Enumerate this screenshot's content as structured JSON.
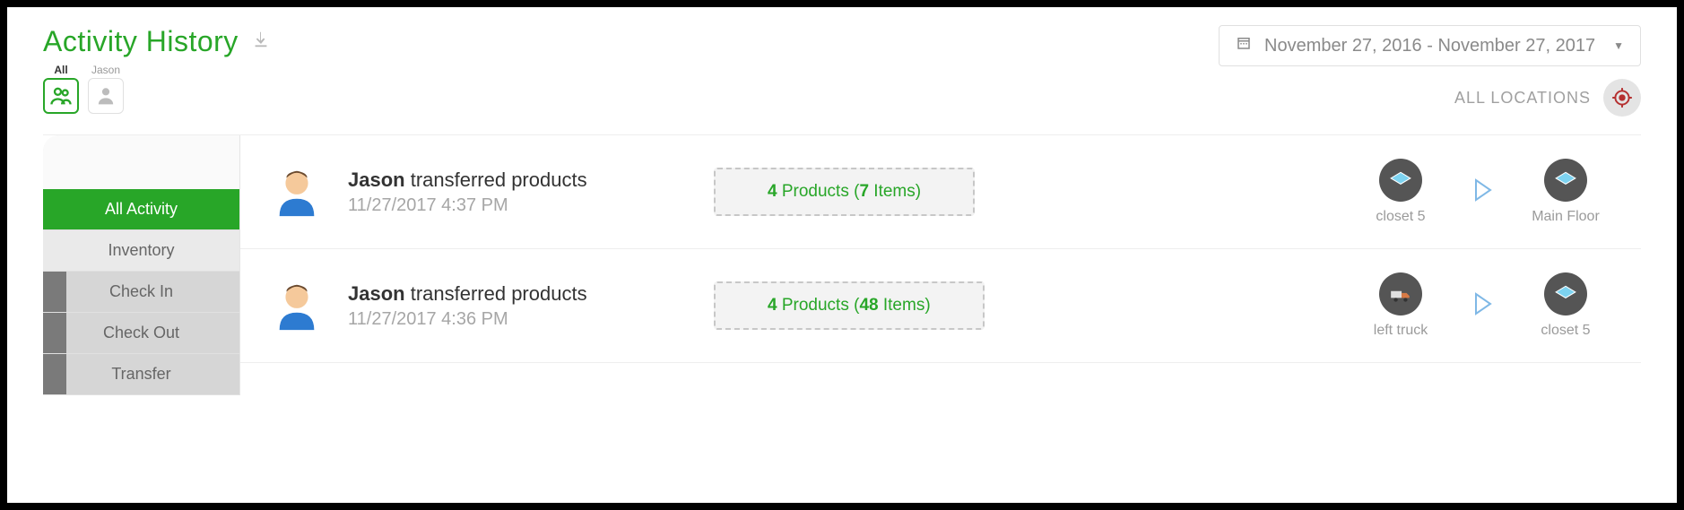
{
  "page": {
    "title": "Activity History",
    "locations_label": "ALL LOCATIONS"
  },
  "dateRange": {
    "text": "November 27, 2016 - November 27, 2017"
  },
  "userFilters": {
    "all": {
      "label": "All"
    },
    "jason": {
      "label": "Jason"
    }
  },
  "sidebar": {
    "items": [
      {
        "label": "All Activity"
      },
      {
        "label": "Inventory"
      },
      {
        "label": "Check In"
      },
      {
        "label": "Check Out"
      },
      {
        "label": "Transfer"
      }
    ]
  },
  "activities": [
    {
      "who": "Jason",
      "verb": " transferred products",
      "time": "11/27/2017 4:37 PM",
      "products_count": "4",
      "products_word": " Products (",
      "items_count": "7",
      "items_word": " Items)",
      "from": "closet 5",
      "from_type": "layer",
      "to": "Main Floor",
      "to_type": "layer"
    },
    {
      "who": "Jason",
      "verb": " transferred products",
      "time": "11/27/2017 4:36 PM",
      "products_count": "4",
      "products_word": " Products (",
      "items_count": "48",
      "items_word": " Items)",
      "from": "left truck",
      "from_type": "truck",
      "to": "closet 5",
      "to_type": "layer"
    }
  ]
}
